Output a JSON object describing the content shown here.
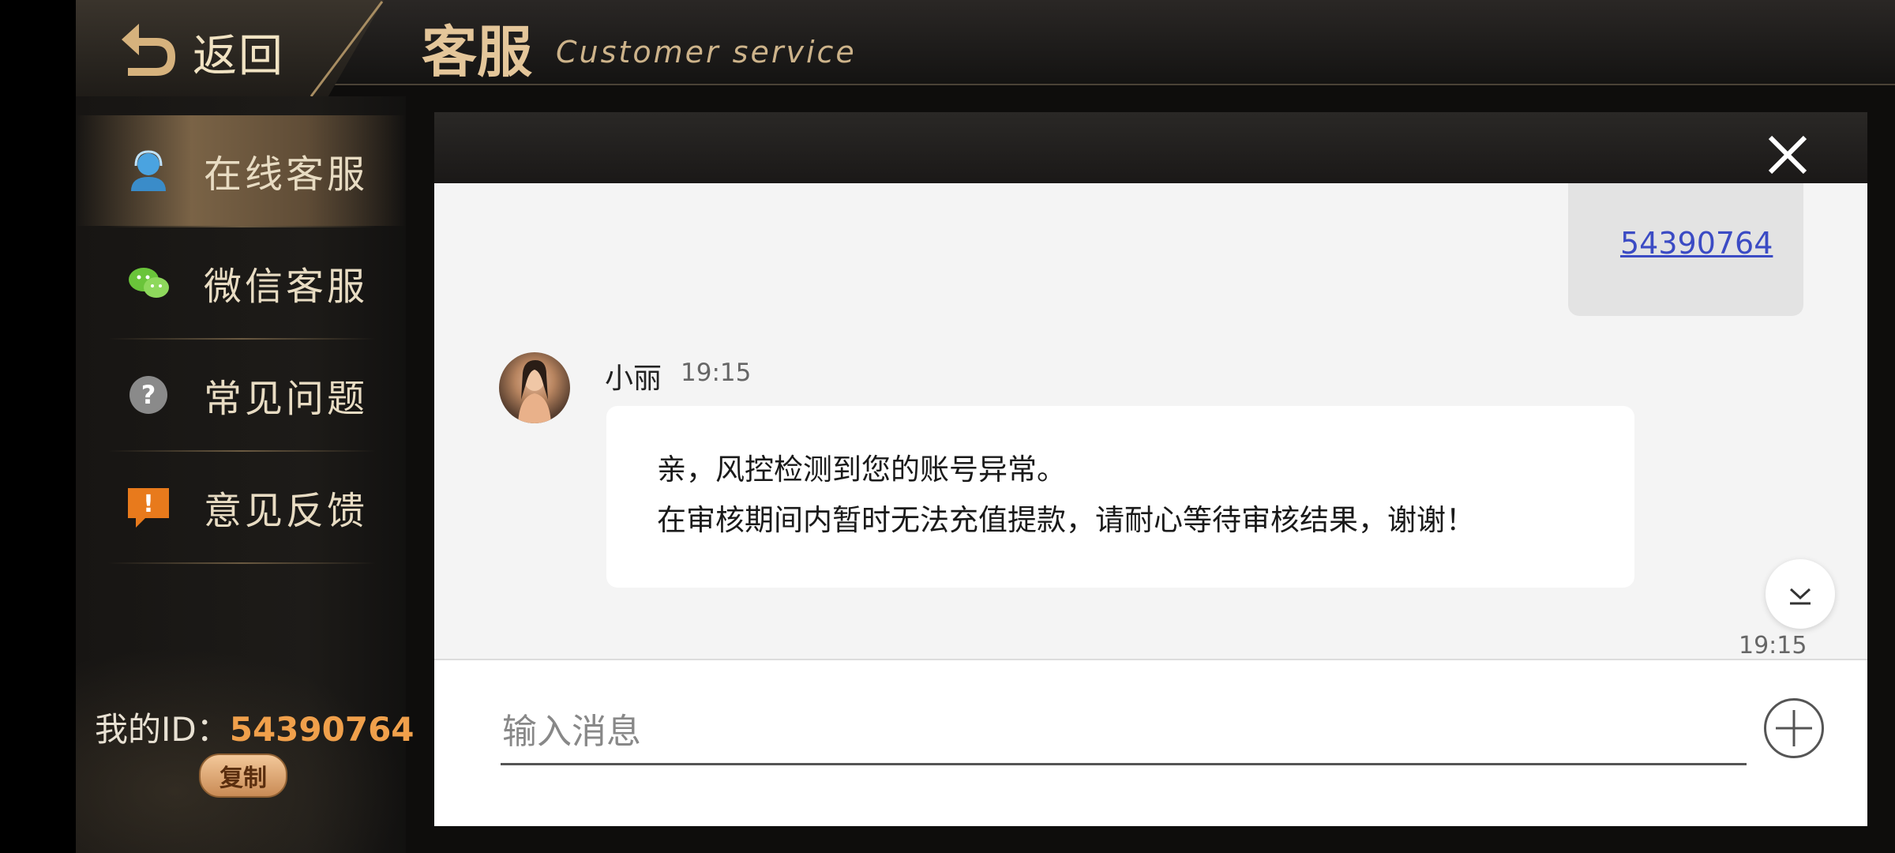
{
  "header": {
    "back_label": "返回",
    "title": "客服",
    "subtitle": "Customer service"
  },
  "sidebar": {
    "items": [
      {
        "label": "在线客服",
        "icon": "agent-icon",
        "active": true
      },
      {
        "label": "微信客服",
        "icon": "wechat-icon",
        "active": false
      },
      {
        "label": "常见问题",
        "icon": "question-icon",
        "active": false
      },
      {
        "label": "意见反馈",
        "icon": "feedback-icon",
        "active": false
      }
    ],
    "my_id_label": "我的ID：",
    "my_id_value": "54390764",
    "copy_label": "复制"
  },
  "chat": {
    "sent_message": "54390764",
    "received": {
      "sender": "小丽",
      "time": "19:15",
      "lines": [
        "亲，风控检测到您的账号异常。",
        "在审核期间内暂时无法充值提款，请耐心等待审核结果，谢谢！"
      ]
    },
    "bottom_time": "19:15"
  },
  "composer": {
    "placeholder": "输入消息"
  },
  "colors": {
    "accent_gold": "#e4c69a",
    "id_orange": "#f0a04b",
    "link_blue": "#3b4bc4",
    "chat_bg": "#f4f4f4"
  }
}
